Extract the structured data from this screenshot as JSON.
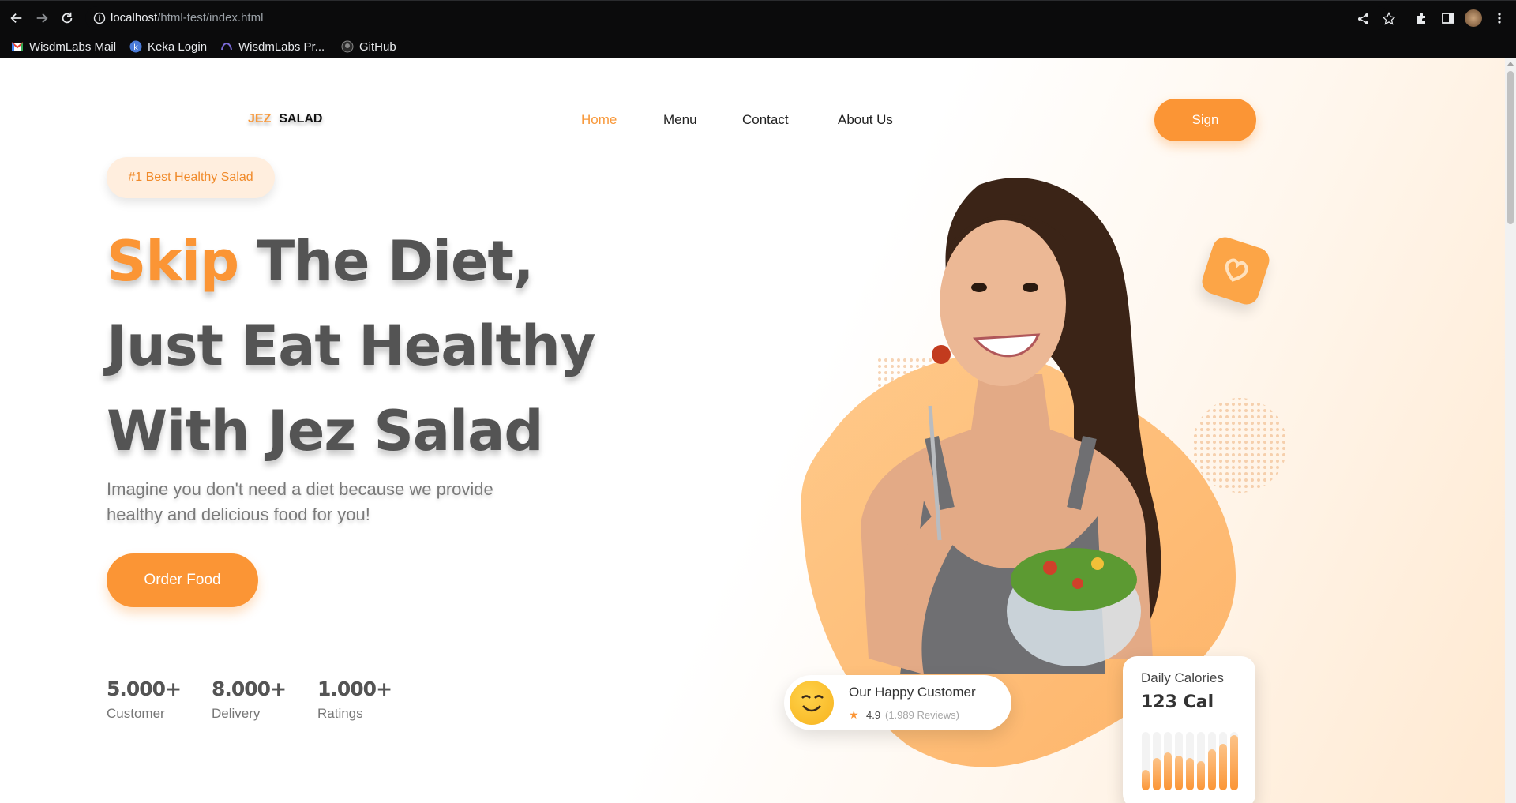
{
  "browser": {
    "url_host": "localhost",
    "url_path": "/html-test/index.html",
    "bookmarks": [
      {
        "label": "WisdmLabs Mail",
        "icon": "gmail-icon"
      },
      {
        "label": "Keka Login",
        "icon": "keka-icon"
      },
      {
        "label": "WisdmLabs Pr...",
        "icon": "wisdmlabs-icon"
      },
      {
        "label": "GitHub",
        "icon": "github-icon"
      }
    ]
  },
  "header": {
    "logo_part1": "JEZ",
    "logo_part2": "SALAD",
    "nav": [
      {
        "label": "Home",
        "active": true
      },
      {
        "label": "Menu",
        "active": false
      },
      {
        "label": "Contact",
        "active": false
      },
      {
        "label": "About Us",
        "active": false
      }
    ],
    "sign_button": "Sign"
  },
  "hero": {
    "badge": "#1 Best Healthy Salad",
    "headline_highlight": "Skip",
    "headline_line1_rest": " The Diet,",
    "headline_line2": "Just Eat Healthy",
    "headline_line3": "With Jez Salad",
    "subtext": "Imagine you don't need a diet because we provide healthy and delicious food for you!",
    "order_button": "Order Food",
    "stats": [
      {
        "value": "5.000+",
        "label": "Customer"
      },
      {
        "value": "8.000+",
        "label": "Delivery"
      },
      {
        "value": "1.000+",
        "label": "Ratings"
      }
    ]
  },
  "customer_card": {
    "title": "Our Happy Customer",
    "rating": "4.9",
    "reviews": "(1.989 Reviews)"
  },
  "calories_card": {
    "title": "Daily Calories",
    "value": "123 Cal",
    "bar_levels": [
      0.35,
      0.55,
      0.65,
      0.6,
      0.55,
      0.5,
      0.7,
      0.8,
      0.95
    ]
  },
  "colors": {
    "accent": "#fb9535",
    "text_dark": "#545454"
  }
}
